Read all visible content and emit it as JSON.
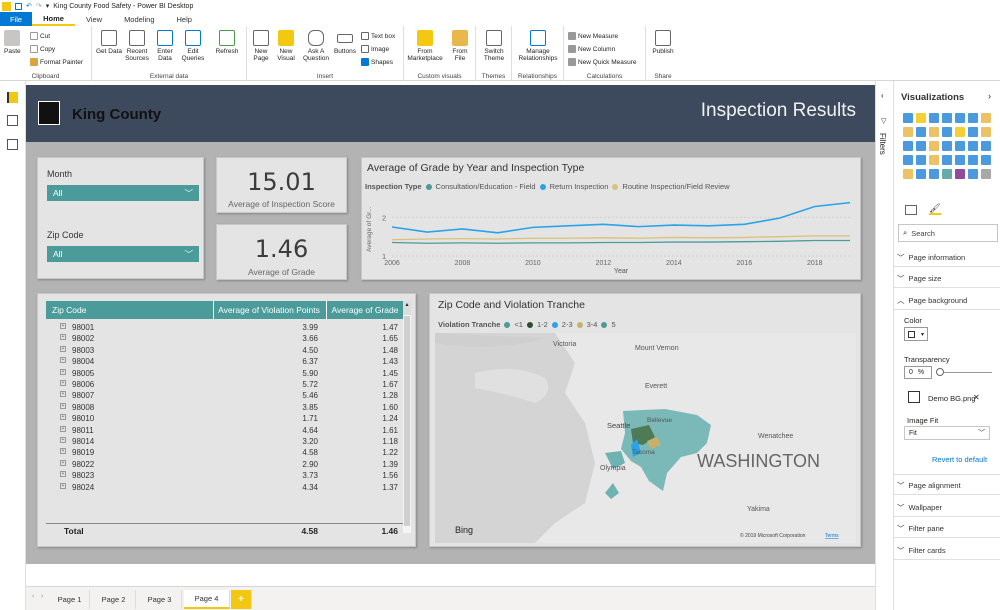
{
  "window": {
    "title": "King County Food Safety - Power BI Desktop"
  },
  "ribbon_tabs": [
    "File",
    "Home",
    "View",
    "Modeling",
    "Help"
  ],
  "ribbon": {
    "clipboard": {
      "label": "Clipboard",
      "paste": "Paste",
      "cut": "Cut",
      "copy": "Copy",
      "format_painter": "Format Painter"
    },
    "external": {
      "label": "External data",
      "get_data": "Get Data",
      "recent_sources": "Recent Sources",
      "enter_data": "Enter Data",
      "edit_queries": "Edit Queries",
      "refresh": "Refresh"
    },
    "insert": {
      "label": "Insert",
      "new_page": "New Page",
      "new_visual": "New Visual",
      "ask_question": "Ask A Question",
      "buttons": "Buttons",
      "text_box": "Text box",
      "image": "Image",
      "shapes": "Shapes"
    },
    "custom": {
      "label": "Custom visuals",
      "marketplace": "From Marketplace",
      "from_file": "From File"
    },
    "themes": {
      "label": "Themes",
      "switch_theme": "Switch Theme"
    },
    "relationships": {
      "label": "Relationships",
      "manage": "Manage Relationships"
    },
    "calculations": {
      "label": "Calculations",
      "new_measure": "New Measure",
      "new_column": "New Column",
      "new_quick_measure": "New Quick Measure"
    },
    "share": {
      "label": "Share",
      "publish": "Publish"
    }
  },
  "report": {
    "brand": "King County",
    "title": "Inspection Results",
    "month_label": "Month",
    "month_value": "All",
    "zip_label": "Zip Code",
    "zip_value": "All",
    "kpi1_value": "15.01",
    "kpi1_label": "Average of Inspection Score",
    "kpi2_value": "1.46",
    "kpi2_label": "Average of Grade"
  },
  "table": {
    "columns": [
      "Zip Code",
      "Average of Violation Points",
      "Average of Grade"
    ],
    "rows": [
      [
        "98001",
        "3.99",
        "1.47"
      ],
      [
        "98002",
        "3.66",
        "1.65"
      ],
      [
        "98003",
        "4.50",
        "1.48"
      ],
      [
        "98004",
        "6.37",
        "1.43"
      ],
      [
        "98005",
        "5.90",
        "1.45"
      ],
      [
        "98006",
        "5.72",
        "1.67"
      ],
      [
        "98007",
        "5.46",
        "1.28"
      ],
      [
        "98008",
        "3.85",
        "1.60"
      ],
      [
        "98010",
        "1.71",
        "1.24"
      ],
      [
        "98011",
        "4.64",
        "1.61"
      ],
      [
        "98014",
        "3.20",
        "1.18"
      ],
      [
        "98019",
        "4.58",
        "1.22"
      ],
      [
        "98022",
        "2.90",
        "1.39"
      ],
      [
        "98023",
        "3.73",
        "1.56"
      ]
    ],
    "partial_row": [
      "98024",
      "4.34",
      "1.37"
    ],
    "total": [
      "Total",
      "4.58",
      "1.46"
    ]
  },
  "map": {
    "title": "Zip Code and Violation Tranche",
    "legend_title": "Violation Tranche",
    "legend": [
      {
        "label": "<1",
        "color": "#4b9b9b"
      },
      {
        "label": "1-2",
        "color": "#2e4d2e"
      },
      {
        "label": "2-3",
        "color": "#2aa3e8"
      },
      {
        "label": "3-4",
        "color": "#c9b06a"
      },
      {
        "label": "5",
        "color": "#4b9b9b"
      }
    ],
    "labels": {
      "victoria": "Victoria",
      "mount_vernon": "Mount Vernon",
      "everett": "Everett",
      "bellevue": "Bellevue",
      "seattle": "Seattle",
      "tacoma": "Tacoma",
      "olympia": "Olympia",
      "wenatchee": "Wenatchee",
      "washington": "WASHINGTON",
      "yakima": "Yakima"
    },
    "bing": "Bing",
    "copyright": "© 2019 Microsoft Corporation",
    "terms": "Terms"
  },
  "chart_data": {
    "type": "line",
    "title": "Average of Grade by Year and Inspection Type",
    "legend_title": "Inspection Type",
    "xlabel": "Year",
    "ylabel": "Average of Gr...",
    "xlim": [
      2006,
      2019
    ],
    "ylim": [
      1,
      2.5
    ],
    "x_ticks": [
      2006,
      2008,
      2010,
      2012,
      2014,
      2016,
      2018
    ],
    "y_ticks": [
      1,
      2
    ],
    "series": [
      {
        "name": "Consultation/Education - Field",
        "color": "#4b9b9b",
        "x": [
          2006,
          2007,
          2008,
          2009,
          2010,
          2011,
          2012,
          2013,
          2014,
          2015,
          2016,
          2017,
          2018,
          2019
        ],
        "values": [
          1.35,
          1.33,
          1.34,
          1.33,
          1.34,
          1.34,
          1.35,
          1.35,
          1.36,
          1.36,
          1.37,
          1.38,
          1.4,
          1.4
        ]
      },
      {
        "name": "Return Inspection",
        "color": "#2aa3e8",
        "x": [
          2006,
          2007,
          2008,
          2009,
          2010,
          2011,
          2012,
          2013,
          2014,
          2015,
          2016,
          2017,
          2018,
          2019
        ],
        "values": [
          1.75,
          1.62,
          1.7,
          1.6,
          1.74,
          1.78,
          1.82,
          1.76,
          1.8,
          1.78,
          1.82,
          1.98,
          2.28,
          2.38
        ]
      },
      {
        "name": "Routine Inspection/Field Review",
        "color": "#d9c27a",
        "x": [
          2006,
          2007,
          2008,
          2009,
          2010,
          2011,
          2012,
          2013,
          2014,
          2015,
          2016,
          2017,
          2018,
          2019
        ],
        "values": [
          1.42,
          1.44,
          1.45,
          1.44,
          1.46,
          1.46,
          1.47,
          1.46,
          1.48,
          1.47,
          1.48,
          1.5,
          1.52,
          1.52
        ]
      }
    ]
  },
  "viz_panel": {
    "title": "Visualizations",
    "filters_label": "Filters",
    "search_placeholder": "Search",
    "sections": [
      "Page information",
      "Page size",
      "Page background"
    ],
    "color_label": "Color",
    "transparency_label": "Transparency",
    "transparency_value": "0",
    "transparency_unit": "%",
    "image_name": "Demo BG.png",
    "image_fit_label": "Image Fit",
    "image_fit_value": "Fit",
    "revert": "Revert to default",
    "sections2": [
      "Page alignment",
      "Wallpaper",
      "Filter pane",
      "Filter cards"
    ]
  },
  "pages": [
    "Page 1",
    "Page 2",
    "Page 3",
    "Page 4"
  ],
  "active_page": "Page 4",
  "add_page": "+"
}
